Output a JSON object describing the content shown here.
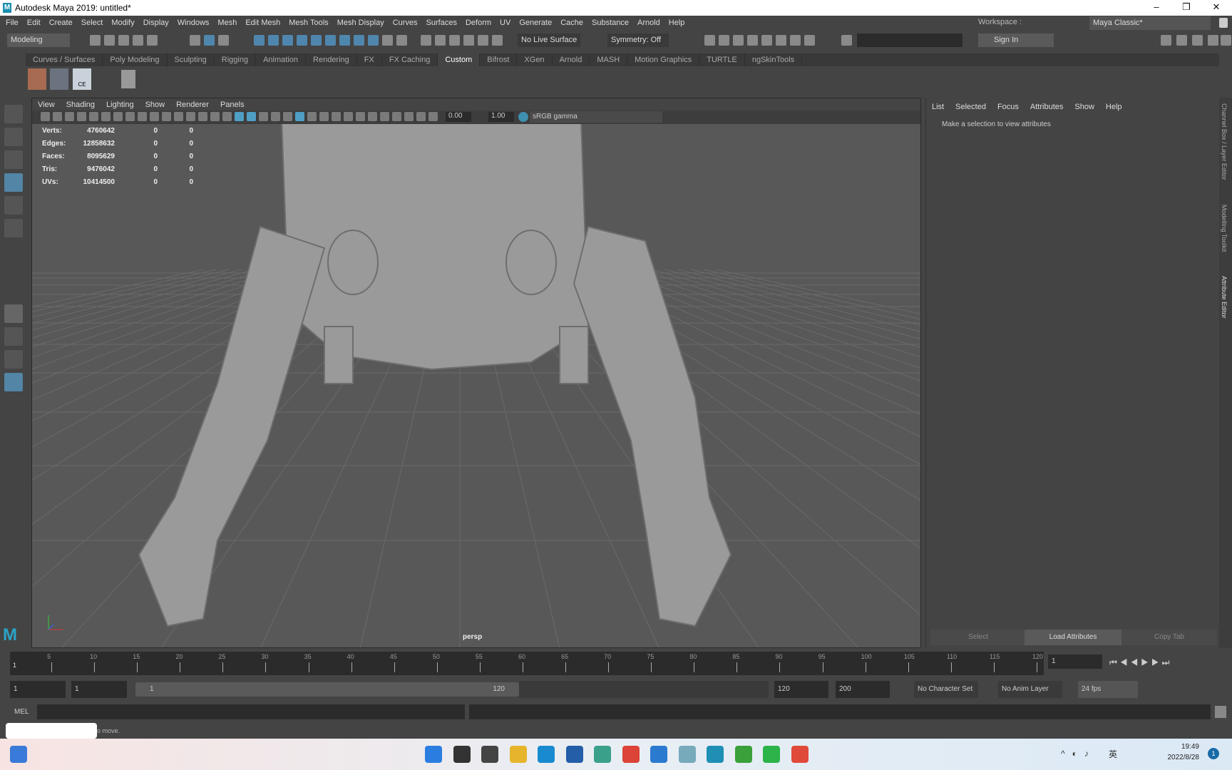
{
  "window": {
    "title": "Autodesk Maya 2019: untitled*",
    "minimize": "–",
    "maximize": "❐",
    "close": "✕"
  },
  "menubar": [
    "File",
    "Edit",
    "Create",
    "Select",
    "Modify",
    "Display",
    "Windows",
    "Mesh",
    "Edit Mesh",
    "Mesh Tools",
    "Mesh Display",
    "Curves",
    "Surfaces",
    "Deform",
    "UV",
    "Generate",
    "Cache",
    "Substance",
    "Arnold",
    "Help"
  ],
  "workspace": {
    "label": "Workspace :",
    "value": "Maya Classic*"
  },
  "toolbar": {
    "menuset": "Modeling",
    "live_surface": "No Live Surface",
    "symmetry": "Symmetry: Off",
    "sign_in": "Sign In"
  },
  "shelf": {
    "tabs": [
      "Curves / Surfaces",
      "Poly Modeling",
      "Sculpting",
      "Rigging",
      "Animation",
      "Rendering",
      "FX",
      "FX Caching",
      "Custom",
      "Bifrost",
      "XGen",
      "Arnold",
      "MASH",
      "Motion Graphics",
      "TURTLE",
      "ngSkinTools"
    ],
    "active": "Custom",
    "ce_label": "CE"
  },
  "viewport": {
    "menu": [
      "View",
      "Shading",
      "Lighting",
      "Show",
      "Renderer",
      "Panels"
    ],
    "exposure": "0.00",
    "gamma": "1.00",
    "color_space": "sRGB gamma",
    "camera": "persp",
    "stats": [
      {
        "label": "Verts:",
        "total": "4760642",
        "sel": "0",
        "comp": "0"
      },
      {
        "label": "Edges:",
        "total": "12858632",
        "sel": "0",
        "comp": "0"
      },
      {
        "label": "Faces:",
        "total": "8095629",
        "sel": "0",
        "comp": "0"
      },
      {
        "label": "Tris:",
        "total": "9476042",
        "sel": "0",
        "comp": "0"
      },
      {
        "label": "UVs:",
        "total": "10414500",
        "sel": "0",
        "comp": "0"
      }
    ]
  },
  "attribute_editor": {
    "menu": [
      "List",
      "Selected",
      "Focus",
      "Attributes",
      "Show",
      "Help"
    ],
    "message": "Make a selection to view attributes",
    "buttons": {
      "select": "Select",
      "load": "Load Attributes",
      "copy": "Copy Tab"
    }
  },
  "side_tabs": [
    "Channel Box / Layer Editor",
    "Modelling Toolkit",
    "Attribute Editor"
  ],
  "timeline": {
    "ticks": [
      5,
      10,
      15,
      20,
      25,
      30,
      35,
      40,
      45,
      50,
      55,
      60,
      65,
      70,
      75,
      80,
      85,
      90,
      95,
      100,
      105,
      110,
      115,
      120
    ],
    "current_marker": "1",
    "current_frame": "1"
  },
  "range": {
    "start": "1",
    "playback_start": "1",
    "slider_start": "1",
    "slider_end": "120",
    "playback_end": "120",
    "end": "200",
    "character_set": "No Character Set",
    "anim_layer": "No Anim Layer",
    "fps": "24 fps"
  },
  "command_line": {
    "label": "MEL",
    "help": "o move."
  },
  "taskbar": {
    "time": "19:49",
    "date": "2022/8/28",
    "ime": "英",
    "notification": "1"
  }
}
